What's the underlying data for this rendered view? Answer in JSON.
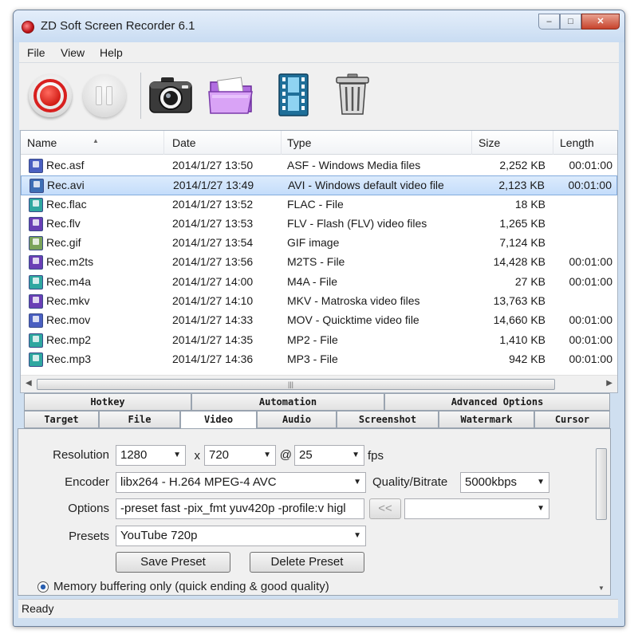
{
  "window": {
    "title": "ZD Soft Screen Recorder 6.1"
  },
  "titlebar_buttons": {
    "minimize": "–",
    "maximize": "□",
    "close": "✕"
  },
  "menu": [
    "File",
    "View",
    "Help"
  ],
  "toolbar": [
    {
      "name": "record",
      "icon": "record-icon"
    },
    {
      "name": "pause",
      "icon": "pause-icon"
    },
    {
      "name": "screenshot",
      "icon": "camera-icon"
    },
    {
      "name": "open-folder",
      "icon": "folder-icon"
    },
    {
      "name": "play-video",
      "icon": "film-icon"
    },
    {
      "name": "delete",
      "icon": "trash-icon"
    }
  ],
  "list": {
    "columns": [
      "Name",
      "Date",
      "Type",
      "Size",
      "Length"
    ],
    "selected_index": 1,
    "rows": [
      {
        "name": "Rec.asf",
        "date": "2014/1/27 13:50",
        "type": "ASF - Windows Media files",
        "size": "2,252 KB",
        "length": "00:01:00",
        "icon_color": "#4a5fc1"
      },
      {
        "name": "Rec.avi",
        "date": "2014/1/27 13:49",
        "type": "AVI - Windows default video file",
        "size": "2,123 KB",
        "length": "00:01:00",
        "icon_color": "#3d6fb5"
      },
      {
        "name": "Rec.flac",
        "date": "2014/1/27 13:52",
        "type": "FLAC - File",
        "size": "18 KB",
        "length": "",
        "icon_color": "#2fa7a0"
      },
      {
        "name": "Rec.flv",
        "date": "2014/1/27 13:53",
        "type": "FLV - Flash (FLV) video files",
        "size": "1,265 KB",
        "length": "",
        "icon_color": "#6a3fb5"
      },
      {
        "name": "Rec.gif",
        "date": "2014/1/27 13:54",
        "type": "GIF image",
        "size": "7,124 KB",
        "length": "",
        "icon_color": "#7aa35a"
      },
      {
        "name": "Rec.m2ts",
        "date": "2014/1/27 13:56",
        "type": "M2TS - File",
        "size": "14,428 KB",
        "length": "00:01:00",
        "icon_color": "#6a3fb5"
      },
      {
        "name": "Rec.m4a",
        "date": "2014/1/27 14:00",
        "type": "M4A - File",
        "size": "27 KB",
        "length": "00:01:00",
        "icon_color": "#2fa7a0"
      },
      {
        "name": "Rec.mkv",
        "date": "2014/1/27 14:10",
        "type": "MKV - Matroska video files",
        "size": "13,763 KB",
        "length": "",
        "icon_color": "#6a3fb5"
      },
      {
        "name": "Rec.mov",
        "date": "2014/1/27 14:33",
        "type": "MOV - Quicktime video file",
        "size": "14,660 KB",
        "length": "00:01:00",
        "icon_color": "#4a5fc1"
      },
      {
        "name": "Rec.mp2",
        "date": "2014/1/27 14:35",
        "type": "MP2 - File",
        "size": "1,410 KB",
        "length": "00:01:00",
        "icon_color": "#2fa7a0"
      },
      {
        "name": "Rec.mp3",
        "date": "2014/1/27 14:36",
        "type": "MP3 - File",
        "size": "942 KB",
        "length": "00:01:00",
        "icon_color": "#2fa7a0"
      }
    ]
  },
  "tabs_top": [
    "Hotkey",
    "Automation",
    "Advanced Options"
  ],
  "tabs_bottom": [
    "Target",
    "File",
    "Video",
    "Audio",
    "Screenshot",
    "Watermark",
    "Cursor"
  ],
  "active_tab": "Video",
  "video": {
    "resolution_label": "Resolution",
    "width": "1280",
    "x_sep": "x",
    "height": "720",
    "at_sep": "@",
    "fps": "25",
    "fps_label": "fps",
    "encoder_label": "Encoder",
    "encoder": "libx264 - H.264 MPEG-4 AVC",
    "quality_label": "Quality/Bitrate",
    "quality": "5000kbps",
    "options_label": "Options",
    "options": "-preset fast -pix_fmt yuv420p -profile:v higl",
    "insert_button": "<<",
    "options_select": "",
    "presets_label": "Presets",
    "preset": "YouTube 720p",
    "save_preset": "Save Preset",
    "delete_preset": "Delete Preset",
    "memory_option": "Memory buffering only (quick ending & good quality)"
  },
  "status": "Ready"
}
